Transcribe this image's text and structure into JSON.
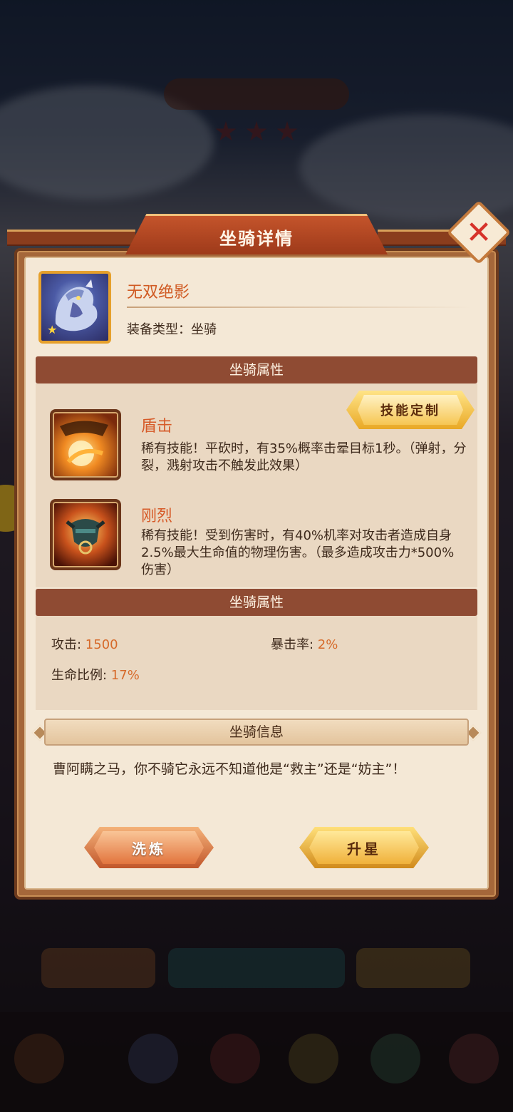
{
  "dialog": {
    "title": "坐骑详情",
    "close_icon": "close-icon"
  },
  "item": {
    "name": "无双绝影",
    "type_label": "装备类型：坐骑",
    "stars": 1
  },
  "sections": {
    "skills_title": "坐骑属性",
    "stats_title": "坐骑属性",
    "info_title": "坐骑信息"
  },
  "custom_skill_button": "技能定制",
  "skills": [
    {
      "name": "盾击",
      "desc": "稀有技能！平砍时，有35%概率击晕目标1秒。（弹射，分裂，溅射攻击不触发此效果）",
      "icon": "shield-bash-icon"
    },
    {
      "name": "刚烈",
      "desc": "稀有技能！受到伤害时，有40%机率对攻击者造成自身2.5%最大生命值的物理伤害。（最多造成攻击力*500%伤害）",
      "icon": "bull-head-icon"
    }
  ],
  "stats": {
    "attack_label": "攻击: ",
    "attack_value": "1500",
    "crit_label": "暴击率: ",
    "crit_value": "2%",
    "hp_label": "生命比例: ",
    "hp_value": "17%"
  },
  "info_text": "曹阿瞒之马，你不骑它永远不知道他是“救主”还是“妨主”！",
  "buttons": {
    "refine": "洗炼",
    "star_up": "升星"
  },
  "colors": {
    "accent_orange": "#d65a28",
    "value_orange": "#d66a2a",
    "panel_cream": "#f4e8d6",
    "section_brown": "#8f4b33"
  }
}
